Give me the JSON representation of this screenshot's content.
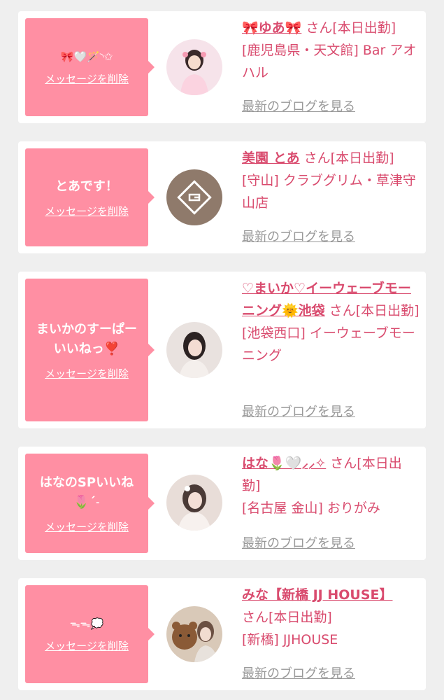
{
  "cards": [
    {
      "message": "🎀🤍🪄◝✩",
      "message_small": true,
      "delete_label": "メッセージを削除",
      "name": "🎀ゆあ🎀",
      "san": " さん[本日出勤]",
      "shop": "[鹿児島県・天文館] Bar アオハル",
      "blog_label": "最新のブログを見る"
    },
    {
      "message": "とあです！",
      "message_small": false,
      "delete_label": "メッセージを削除",
      "name": "美園 とあ",
      "san": " さん[本日出勤]",
      "shop": "[守山] クラブグリム・草津守山店",
      "blog_label": "最新のブログを見る"
    },
    {
      "message": "まいかのすーぱー\nいいねっ❣️",
      "message_small": false,
      "delete_label": "メッセージを削除",
      "name": "♡まいか♡イーウェーブモーニング🌞池袋",
      "san": " さん[本日出勤]",
      "shop": "[池袋西口] イーウェーブモーニング",
      "blog_label": "最新のブログを見る"
    },
    {
      "message": "はなのSPいいね\n🌷ˊ˗",
      "message_small": false,
      "delete_label": "メッセージを削除",
      "name": "はな🌷🤍⸝⸝✧",
      "san": " さん[本日出勤]",
      "shop": "[名古屋 金山] おりがみ",
      "blog_label": "最新のブログを見る"
    },
    {
      "message": "ᯓᯓ💭",
      "message_small": true,
      "delete_label": "メッセージを削除",
      "name": "みな【新橋 JJ HOUSE】",
      "san": " さん[本日出勤]",
      "shop": "[新橋] JJHOUSE",
      "blog_label": "最新のブログを見る"
    }
  ],
  "colors": {
    "accent": "#d94b6e",
    "bubble": "#ff8fa3",
    "muted": "#999999",
    "background": "#efefef"
  },
  "icons": {
    "avatar_1": "girl-photo-avatar",
    "avatar_2": "shop-logo-avatar",
    "avatar_3": "girl-photo-avatar",
    "avatar_4": "girl-photo-avatar",
    "avatar_5": "girl-with-teddy-avatar"
  }
}
